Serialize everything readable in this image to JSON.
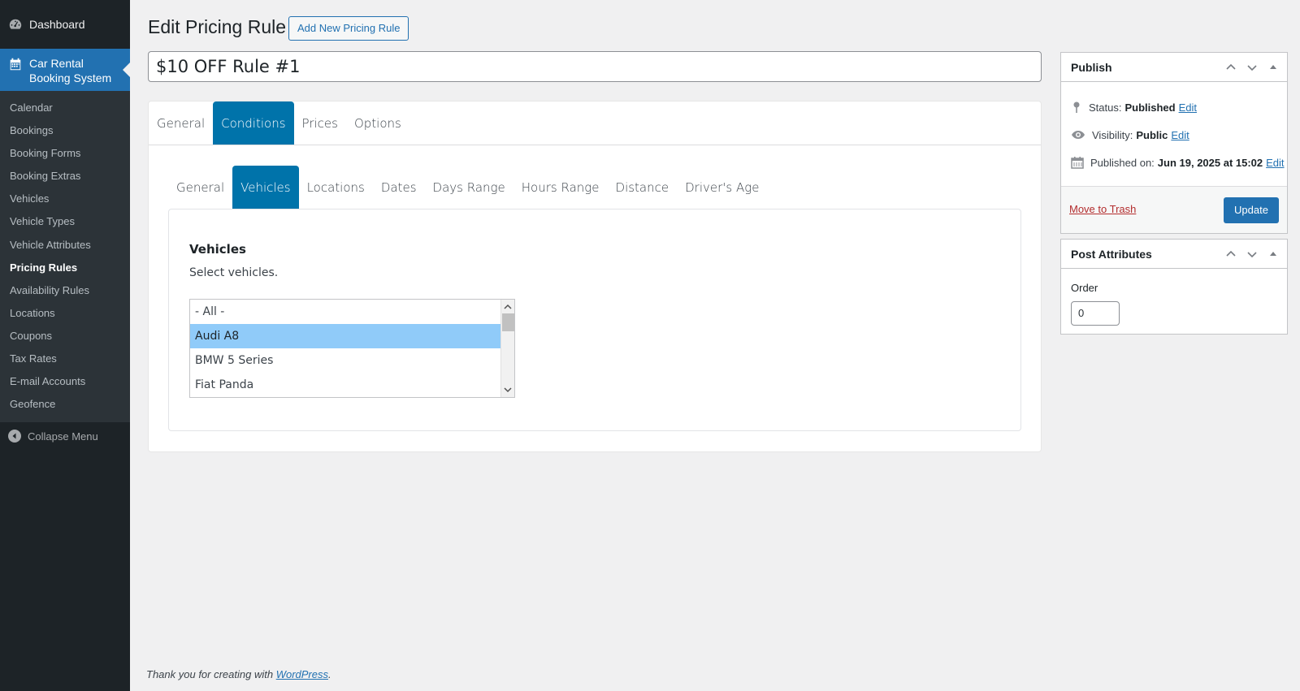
{
  "sidebar": {
    "dashboard_label": "Dashboard",
    "plugin_label_line1": "Car Rental",
    "plugin_label_line2": "Booking System",
    "submenu": [
      {
        "label": "Calendar"
      },
      {
        "label": "Bookings"
      },
      {
        "label": "Booking Forms"
      },
      {
        "label": "Booking Extras"
      },
      {
        "label": "Vehicles"
      },
      {
        "label": "Vehicle Types"
      },
      {
        "label": "Vehicle Attributes"
      },
      {
        "label": "Pricing Rules"
      },
      {
        "label": "Availability Rules"
      },
      {
        "label": "Locations"
      },
      {
        "label": "Coupons"
      },
      {
        "label": "Tax Rates"
      },
      {
        "label": "E-mail Accounts"
      },
      {
        "label": "Geofence"
      }
    ],
    "collapse_label": "Collapse Menu"
  },
  "header": {
    "title": "Edit Pricing Rule",
    "add_new_label": "Add New Pricing Rule"
  },
  "post_title": "$10 OFF Rule #1",
  "tabs": [
    "General",
    "Conditions",
    "Prices",
    "Options"
  ],
  "sub_tabs": [
    "General",
    "Vehicles",
    "Locations",
    "Dates",
    "Days Range",
    "Hours Range",
    "Distance",
    "Driver's Age"
  ],
  "vehicles_field": {
    "title": "Vehicles",
    "description": "Select vehicles.",
    "options": [
      "- All -",
      "Audi A8",
      "BMW 5 Series",
      "Fiat Panda"
    ]
  },
  "publish": {
    "title": "Publish",
    "status_label": "Status:",
    "status_value": "Published",
    "visibility_label": "Visibility:",
    "visibility_value": "Public",
    "published_label": "Published on:",
    "published_value": "Jun 19, 2025 at 15:02",
    "edit_label": "Edit",
    "trash_label": "Move to Trash",
    "update_label": "Update"
  },
  "post_attributes": {
    "title": "Post Attributes",
    "order_label": "Order",
    "order_value": "0"
  },
  "footer": {
    "text": "Thank you for creating with ",
    "link": "WordPress",
    "suffix": "."
  },
  "colors": {
    "sidebar_bg": "#1d2327",
    "accent": "#2271b1",
    "tab_active": "#0073aa",
    "selected_option": "#90cbf9"
  }
}
